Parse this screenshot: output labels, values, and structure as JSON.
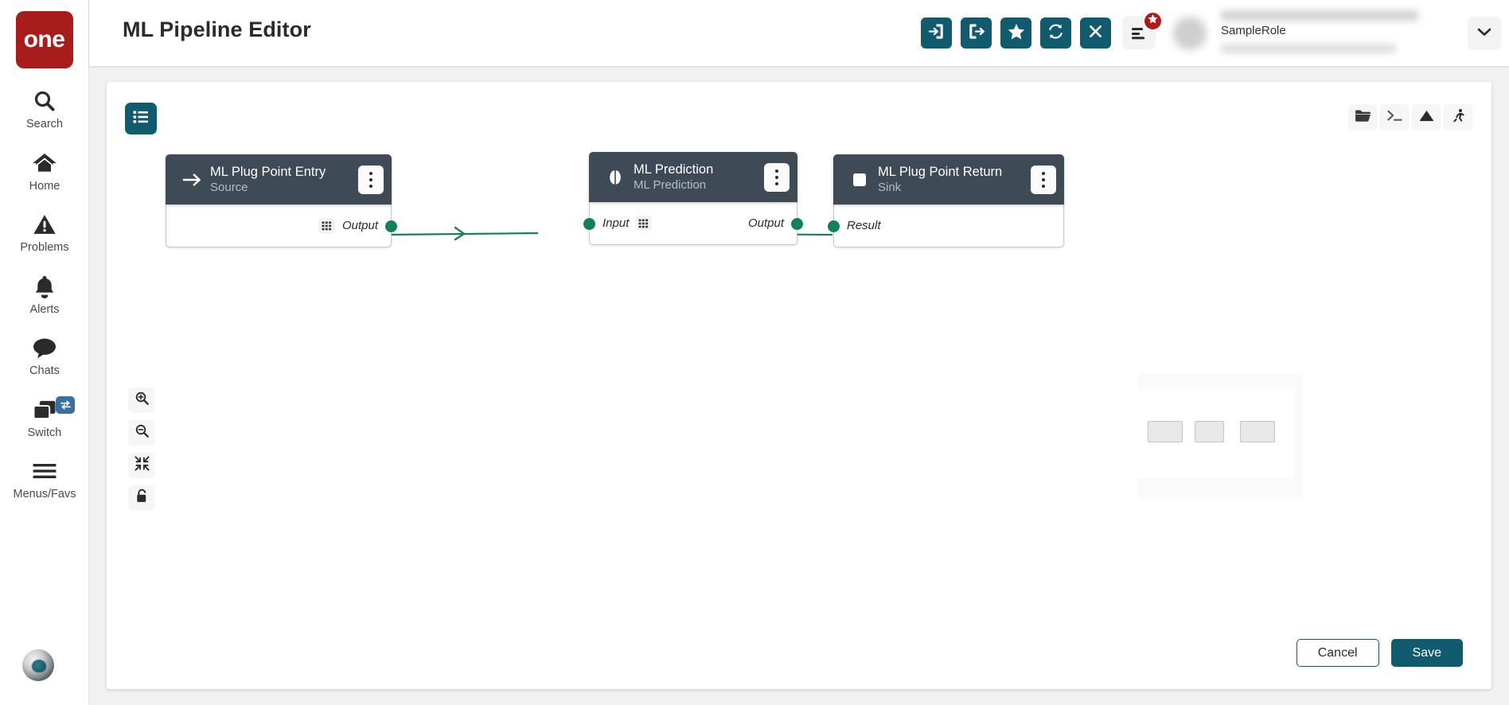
{
  "brand": {
    "logo_text": "one",
    "logo_color": "#a81c1c"
  },
  "theme": {
    "accent": "#105b6e",
    "node_header": "#3e4a56",
    "edge": "#138058",
    "badge_blue": "#3871a1",
    "badge_red": "#b01a1a"
  },
  "sidebar": {
    "items": [
      {
        "label": "Search",
        "icon": "search-icon"
      },
      {
        "label": "Home",
        "icon": "home-icon"
      },
      {
        "label": "Problems",
        "icon": "warning-triangle-icon"
      },
      {
        "label": "Alerts",
        "icon": "bell-icon"
      },
      {
        "label": "Chats",
        "icon": "chat-bubble-icon"
      },
      {
        "label": "Switch",
        "icon": "windows-stack-icon",
        "badge_icon": "swap-arrows-icon"
      },
      {
        "label": "Menus/Favs",
        "icon": "hamburger-icon"
      }
    ],
    "avatar": "user-avatar"
  },
  "header": {
    "title": "ML Pipeline Editor",
    "actions": [
      {
        "name": "import-button",
        "icon": "file-import-icon"
      },
      {
        "name": "export-button",
        "icon": "file-export-icon"
      },
      {
        "name": "favorite-button",
        "icon": "star-icon"
      },
      {
        "name": "refresh-button",
        "icon": "sync-refresh-icon"
      },
      {
        "name": "close-button",
        "icon": "close-x-icon"
      }
    ],
    "menu_icon": "list-menu-icon",
    "menu_badge_icon": "star-icon",
    "user_role": "SampleRole",
    "dropdown_icon": "chevron-down-icon"
  },
  "canvas": {
    "palette_button_icon": "list-icon",
    "tools": [
      {
        "name": "open-folder-tool",
        "icon": "folder-icon"
      },
      {
        "name": "console-tool",
        "icon": "terminal-icon"
      },
      {
        "name": "deploy-tool",
        "icon": "mountain-icon"
      },
      {
        "name": "run-tool",
        "icon": "runner-icon"
      }
    ],
    "zoom_tools": [
      {
        "name": "zoom-in-button",
        "icon": "zoom-in-icon"
      },
      {
        "name": "zoom-out-button",
        "icon": "zoom-out-icon"
      },
      {
        "name": "fit-to-screen-button",
        "icon": "compress-arrows-icon"
      },
      {
        "name": "lock-canvas-button",
        "icon": "padlock-icon"
      }
    ],
    "nodes": [
      {
        "id": "ml-plug-point-entry",
        "title": "ML Plug Point Entry",
        "subtitle": "Source",
        "icon": "arrow-right-icon",
        "kebab_icon": "kebab-menu-icon",
        "ports": {
          "output": "Output",
          "output_icon": "grid-icon"
        }
      },
      {
        "id": "ml-prediction",
        "title": "ML Prediction",
        "subtitle": "ML Prediction",
        "icon": "brain-icon",
        "kebab_icon": "kebab-menu-icon",
        "ports": {
          "input": "Input",
          "input_icon": "grid-icon",
          "output": "Output"
        }
      },
      {
        "id": "ml-plug-point-return",
        "title": "ML Plug Point Return",
        "subtitle": "Sink",
        "icon": "square-icon",
        "kebab_icon": "kebab-menu-icon",
        "ports": {
          "input": "Result"
        }
      }
    ],
    "edges": [
      {
        "from": "ml-plug-point-entry.Output",
        "to": "ml-prediction.Input"
      },
      {
        "from": "ml-prediction.Output",
        "to": "ml-plug-point-return.Result"
      }
    ],
    "minimap": {
      "name": "canvas-minimap",
      "node_count": 3
    }
  },
  "footer": {
    "cancel_label": "Cancel",
    "save_label": "Save"
  }
}
